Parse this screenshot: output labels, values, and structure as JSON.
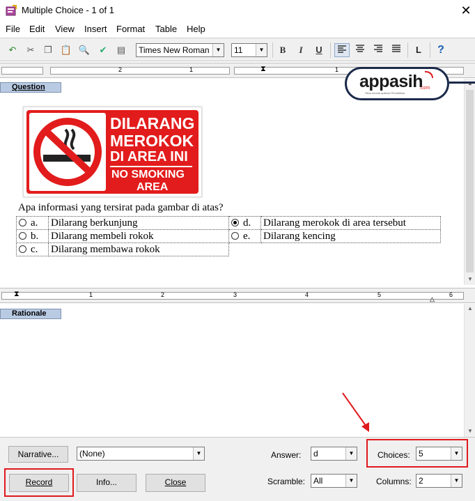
{
  "window": {
    "title": "Multiple Choice - 1 of 1",
    "close": "✕"
  },
  "menu": [
    "File",
    "Edit",
    "View",
    "Insert",
    "Format",
    "Table",
    "Help"
  ],
  "toolbar": {
    "font_name": "Times New Roman",
    "font_size": "11",
    "bold": "B",
    "italic": "I",
    "underline": "U",
    "help": "?"
  },
  "ruler_top": {
    "numbers": [
      "2",
      "1",
      "1"
    ]
  },
  "ruler_bottom": {
    "numbers": [
      "1",
      "2",
      "3",
      "4",
      "5",
      "6"
    ]
  },
  "logo": {
    "text": "appasih",
    "suffix": ".com",
    "tagline": "Situs tutorial aplikasi Pendidikan"
  },
  "sections": {
    "question": "Question",
    "rationale": "Rationale"
  },
  "sign": {
    "line1": "DILARANG",
    "line2": "MEROKOK",
    "line3": "DI AREA INI",
    "line4": "NO SMOKING",
    "line5": "AREA"
  },
  "question": {
    "text": "Apa informasi yang tersirat pada gambar di atas?",
    "choices": [
      {
        "letter": "a.",
        "text": "Dilarang berkunjung",
        "selected": false
      },
      {
        "letter": "b.",
        "text": "Dilarang membeli rokok",
        "selected": false
      },
      {
        "letter": "c.",
        "text": "Dilarang membawa rokok",
        "selected": false
      },
      {
        "letter": "d.",
        "text": "Dilarang merokok di area tersebut",
        "selected": true
      },
      {
        "letter": "e.",
        "text": "Dilarang kencing",
        "selected": false
      }
    ]
  },
  "bottom": {
    "narrative_button": "Narrative...",
    "narrative_value": "(None)",
    "answer_label": "Answer:",
    "answer_value": "d",
    "choices_label": "Choices:",
    "choices_value": "5",
    "record_button": "Record",
    "info_button": "Info...",
    "close_button": "Close",
    "scramble_label": "Scramble:",
    "scramble_value": "All",
    "columns_label": "Columns:",
    "columns_value": "2"
  },
  "colors": {
    "highlight": "#e0191d",
    "section_tab": "#b9cbe3",
    "sign_red": "#e21c1c"
  }
}
